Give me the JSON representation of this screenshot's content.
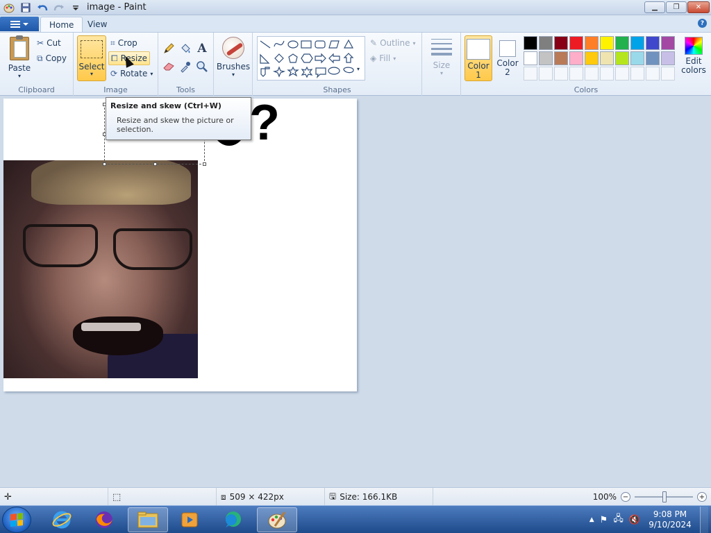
{
  "window": {
    "title": "image - Paint"
  },
  "tabs": {
    "home": "Home",
    "view": "View"
  },
  "ribbon": {
    "clipboard": {
      "label": "Clipboard",
      "paste": "Paste",
      "cut": "Cut",
      "copy": "Copy"
    },
    "image": {
      "label": "Image",
      "select": "Select",
      "crop": "Crop",
      "resize": "Resize",
      "rotate": "Rotate"
    },
    "tools": {
      "label": "Tools"
    },
    "brushes": {
      "label": "Brushes"
    },
    "shapes": {
      "label": "Shapes",
      "outline": "Outline",
      "fill": "Fill"
    },
    "size": {
      "label": "Size"
    },
    "colors": {
      "label": "Colors",
      "color1": "Color 1",
      "color2": "Color 2",
      "edit": "Edit colors",
      "palette_row1": [
        "#000000",
        "#7f7f7f",
        "#880015",
        "#ed1c24",
        "#ff7f27",
        "#fff200",
        "#22b14c",
        "#00a2e8",
        "#3f48cc",
        "#a349a4"
      ],
      "palette_row2": [
        "#ffffff",
        "#c3c3c3",
        "#b97a57",
        "#ffaec9",
        "#ffc90e",
        "#efe4b0",
        "#b5e61d",
        "#99d9ea",
        "#7092be",
        "#c8bfe7"
      ]
    }
  },
  "canvas": {
    "text": "??"
  },
  "tooltip": {
    "title": "Resize and skew (Ctrl+W)",
    "body": "Resize and skew the picture or selection."
  },
  "status": {
    "dimensions": "509 × 422px",
    "size": "Size: 166.1KB",
    "zoom": "100%"
  },
  "taskbar": {
    "time": "9:08 PM",
    "date": "9/10/2024"
  }
}
